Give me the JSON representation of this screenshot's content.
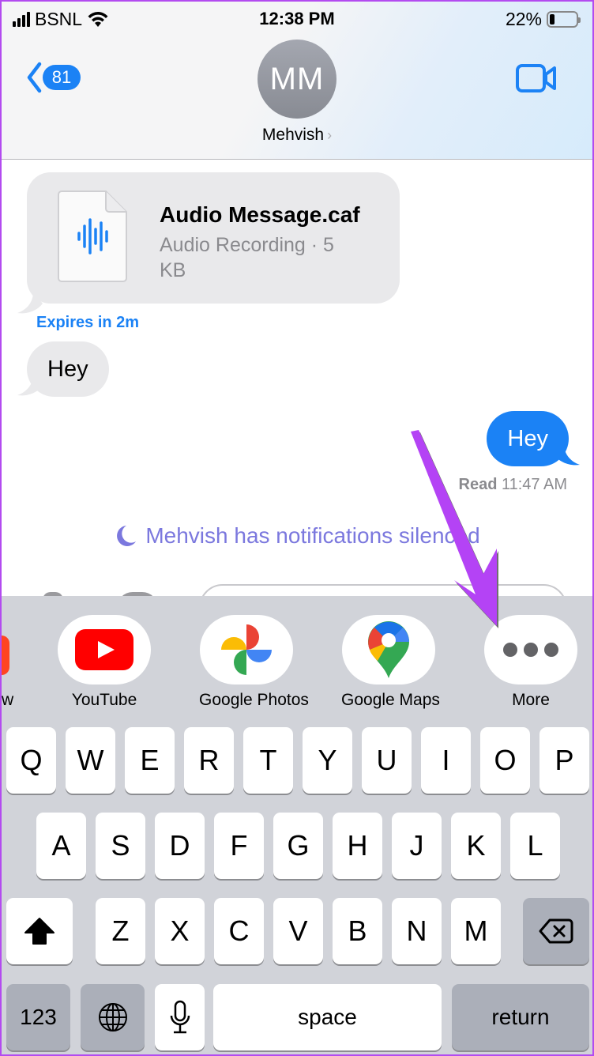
{
  "status_bar": {
    "carrier": "BSNL",
    "time": "12:38 PM",
    "battery_percent": "22%",
    "battery_level": 0.22
  },
  "header": {
    "back_badge": "81",
    "avatar_initials": "MM",
    "contact_name": "Mehvish",
    "contact_chevron": "›"
  },
  "messages": {
    "attachment": {
      "file_name": "Audio Message.caf",
      "file_meta": "Audio Recording · 5 KB",
      "expires": "Expires in 2m"
    },
    "incoming_text": "Hey",
    "outgoing_text": "Hey",
    "read_label": "Read",
    "read_time": "11:47 AM",
    "silenced_notice": "Mehvish has notifications silenced"
  },
  "app_strip": {
    "partial_label": "w",
    "apps": [
      {
        "label": "YouTube",
        "icon": "youtube-icon"
      },
      {
        "label": "Google Photos",
        "icon": "google-photos-icon"
      },
      {
        "label": "Google Maps",
        "icon": "google-maps-icon"
      },
      {
        "label": "More",
        "icon": "more-dots-icon"
      }
    ]
  },
  "keyboard": {
    "row1": [
      "Q",
      "W",
      "E",
      "R",
      "T",
      "Y",
      "U",
      "I",
      "O",
      "P"
    ],
    "row2": [
      "A",
      "S",
      "D",
      "F",
      "G",
      "H",
      "J",
      "K",
      "L"
    ],
    "row3": [
      "Z",
      "X",
      "C",
      "V",
      "B",
      "N",
      "M"
    ],
    "numbers_label": "123",
    "space_label": "space",
    "return_label": "return"
  },
  "annotation": {
    "arrow_color": "#b443f5",
    "points_to": "More"
  },
  "colors": {
    "accent_blue": "#1b82f5",
    "silenced_purple": "#7b78de",
    "bubble_gray": "#e9e9eb",
    "keyboard_bg": "#d1d3d9"
  }
}
